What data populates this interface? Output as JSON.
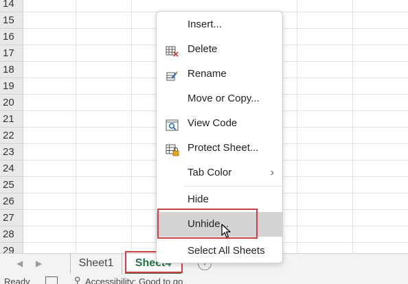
{
  "grid": {
    "rows": [
      "14",
      "15",
      "16",
      "17",
      "18",
      "19",
      "20",
      "21",
      "22",
      "23",
      "24",
      "25",
      "26",
      "27",
      "28",
      "29"
    ]
  },
  "tabs": {
    "sheets": [
      "Sheet1",
      "Sheet4"
    ],
    "active": "Sheet4",
    "add_icon": "plus-icon",
    "nav_prev_icon": "triangle-left-icon",
    "nav_next_icon": "triangle-right-icon"
  },
  "status": {
    "ready": "Ready",
    "accessibility": "Accessibility: Good to go"
  },
  "context_menu": {
    "items": [
      {
        "label": "Insert...",
        "icon": ""
      },
      {
        "label": "Delete",
        "icon": "delete-sheet-icon"
      },
      {
        "label": "Rename",
        "icon": "rename-icon"
      },
      {
        "label": "Move or Copy...",
        "icon": ""
      },
      {
        "label": "View Code",
        "icon": "view-code-icon"
      },
      {
        "label": "Protect Sheet...",
        "icon": "protect-sheet-icon"
      },
      {
        "label": "Tab Color",
        "icon": "",
        "submenu": true
      },
      {
        "label": "Hide",
        "icon": ""
      },
      {
        "label": "Unhide...",
        "icon": "",
        "hovered": true
      },
      {
        "label": "Select All Sheets",
        "icon": ""
      }
    ]
  },
  "colors": {
    "accent_green": "#217346",
    "highlight_red": "#e23a3a",
    "hover_gray": "#d4d4d4"
  }
}
